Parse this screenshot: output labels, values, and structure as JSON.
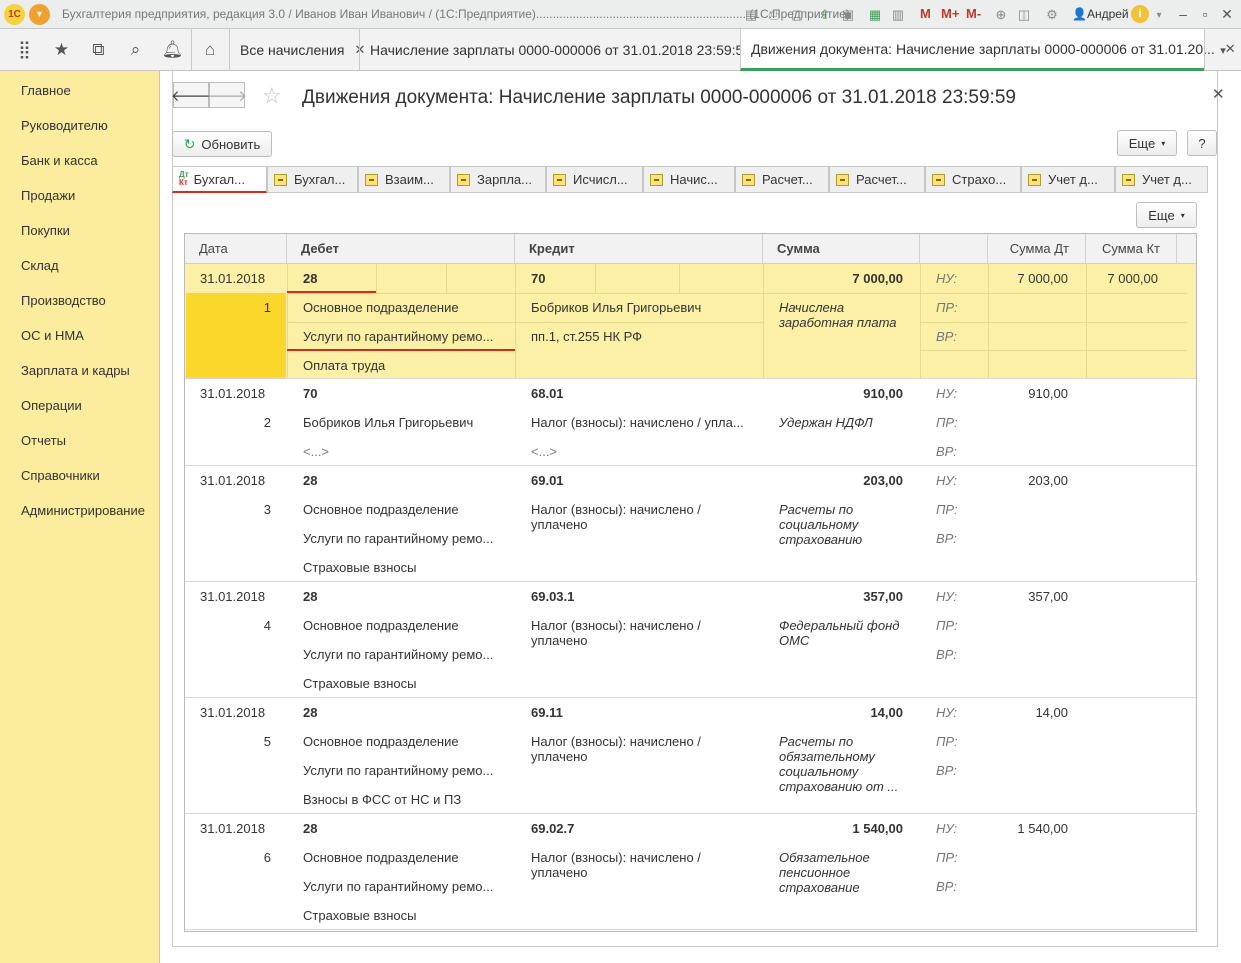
{
  "titlebar": {
    "app_title": "Бухгалтерия предприятия, редакция 3.0 / Иванов Иван Иванович / (1С:Предприятие)...............................................................  (1С:Предприятие)",
    "logo_text": "1С",
    "m_labels": [
      "M",
      "M+",
      "M-"
    ],
    "user": "Андрей",
    "icons": [
      "save-icon",
      "print-icon",
      "preview-icon",
      "upload-icon",
      "scan-icon",
      "calculator-icon",
      "calendar-icon",
      "zoom-icon",
      "window-icon",
      "settings-icon",
      "info-icon",
      "menu-icon",
      "minimize-icon",
      "maximize-icon",
      "close-icon"
    ]
  },
  "tabbar": {
    "icons": [
      "apps-grid-icon",
      "favorites-star-icon",
      "history-icon",
      "search-icon",
      "bell-icon",
      "home-icon"
    ],
    "tabs": [
      {
        "label": "Все начисления",
        "active": false
      },
      {
        "label": "Начисление зарплаты 0000-000006 от 31.01.2018 23:59:59",
        "active": false
      },
      {
        "label": "Движения документа: Начисление зарплаты 0000-000006 от 31.01.20...",
        "active": true
      }
    ]
  },
  "sidebar": {
    "items": [
      "Главное",
      "Руководителю",
      "Банк и касса",
      "Продажи",
      "Покупки",
      "Склад",
      "Производство",
      "ОС и НМА",
      "Зарплата и кадры",
      "Операции",
      "Отчеты",
      "Справочники",
      "Администрирование"
    ]
  },
  "document": {
    "title": "Движения документа: Начисление зарплаты 0000-000006 от 31.01.2018 23:59:59",
    "refresh_label": "Обновить",
    "more_label": "Еще",
    "help_label": "?",
    "grid_more_label": "Еще",
    "subtabs": [
      "Бухгал...",
      "Бухгал...",
      "Взаим...",
      "Зарпла...",
      "Исчисл...",
      "Начис...",
      "Расчет...",
      "Расчет...",
      "Страхо...",
      "Учет д...",
      "Учет д..."
    ],
    "dtkt_icon": {
      "top": "Дт",
      "bottom": "Кт"
    }
  },
  "grid": {
    "headers": [
      "Дата",
      "Дебет",
      "Кредит",
      "Сумма",
      "",
      "Сумма Дт",
      "Сумма Кт"
    ],
    "rows": [
      {
        "date": "31.01.2018",
        "num": "1",
        "debit": [
          "28",
          "Основное подразделение",
          "Услуги по гарантийному ремо...",
          "Оплата труда"
        ],
        "credit": [
          "70",
          "Бобриков Илья Григорьевич",
          "пп.1, ст.255 НК РФ",
          ""
        ],
        "sum": "7 000,00",
        "desc": "Начислена заработная плата",
        "nu": "НУ:",
        "pr": "ПР:",
        "vr": "ВР:",
        "sum_dt": "7 000,00",
        "sum_kt": "7 000,00"
      },
      {
        "date": "31.01.2018",
        "num": "2",
        "debit": [
          "70",
          "Бобриков Илья Григорьевич",
          "<...>",
          ""
        ],
        "credit": [
          "68.01",
          "Налог (взносы): начислено / упла...",
          "<...>",
          ""
        ],
        "sum": "910,00",
        "desc": "Удержан НДФЛ",
        "nu": "НУ:",
        "pr": "ПР:",
        "vr": "ВР:",
        "sum_dt": "910,00",
        "sum_kt": ""
      },
      {
        "date": "31.01.2018",
        "num": "3",
        "debit": [
          "28",
          "Основное подразделение",
          "Услуги по гарантийному ремо...",
          "Страховые взносы"
        ],
        "credit": [
          "69.01",
          "Налог (взносы): начислено / уплачено",
          "",
          ""
        ],
        "sum": "203,00",
        "desc": "Расчеты по социальному страхованию",
        "nu": "НУ:",
        "pr": "ПР:",
        "vr": "ВР:",
        "sum_dt": "203,00",
        "sum_kt": ""
      },
      {
        "date": "31.01.2018",
        "num": "4",
        "debit": [
          "28",
          "Основное подразделение",
          "Услуги по гарантийному ремо...",
          "Страховые взносы"
        ],
        "credit": [
          "69.03.1",
          "Налог (взносы): начислено / уплачено",
          "",
          ""
        ],
        "sum": "357,00",
        "desc": "Федеральный фонд ОМС",
        "nu": "НУ:",
        "pr": "ПР:",
        "vr": "ВР:",
        "sum_dt": "357,00",
        "sum_kt": ""
      },
      {
        "date": "31.01.2018",
        "num": "5",
        "debit": [
          "28",
          "Основное подразделение",
          "Услуги по гарантийному ремо...",
          "Взносы в ФСС от НС и ПЗ"
        ],
        "credit": [
          "69.11",
          "Налог (взносы): начислено / уплачено",
          "",
          ""
        ],
        "sum": "14,00",
        "desc": "Расчеты по обязательному социальному страхованию от ...",
        "nu": "НУ:",
        "pr": "ПР:",
        "vr": "ВР:",
        "sum_dt": "14,00",
        "sum_kt": ""
      },
      {
        "date": "31.01.2018",
        "num": "6",
        "debit": [
          "28",
          "Основное подразделение",
          "Услуги по гарантийному ремо...",
          "Страховые взносы"
        ],
        "credit": [
          "69.02.7",
          "Налог (взносы): начислено / уплачено",
          "",
          ""
        ],
        "sum": "1 540,00",
        "desc": "Обязательное пенсионное страхование",
        "nu": "НУ:",
        "pr": "ПР:",
        "vr": "ВР:",
        "sum_dt": "1 540,00",
        "sum_kt": ""
      }
    ]
  }
}
